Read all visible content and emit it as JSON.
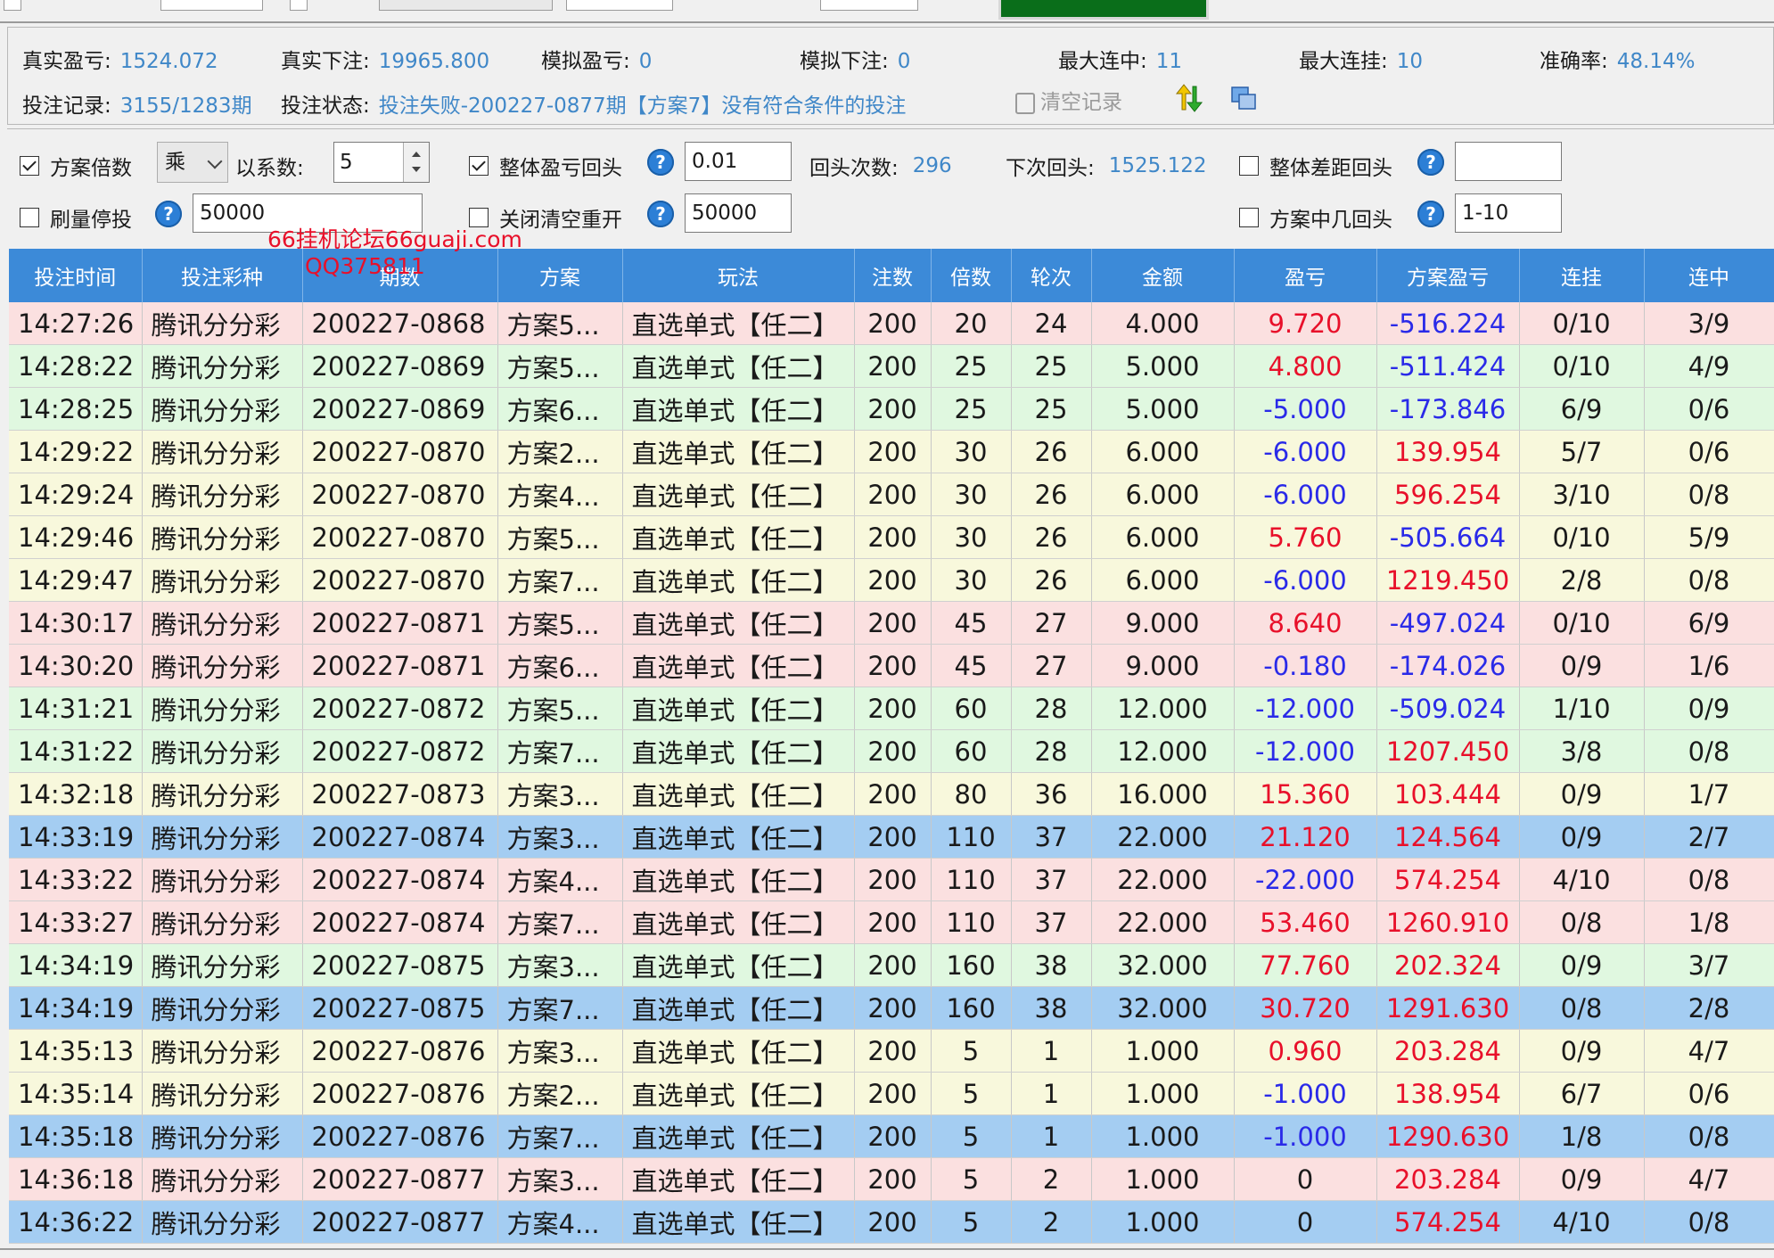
{
  "colors": {
    "header_bg": "#3c8ad8",
    "value_blue": "#3f87c8",
    "profit_red": "#e8102a",
    "loss_blue": "#2a2ae8",
    "row_pink": "#fbe0e0",
    "row_green": "#e0f8e0",
    "row_yellow": "#f8f8dc",
    "row_blue": "#a4cdf2"
  },
  "stats": {
    "real_profit": {
      "label": "真实盈亏:",
      "value": "1524.072"
    },
    "real_bet": {
      "label": "真实下注:",
      "value": "19965.800"
    },
    "sim_profit": {
      "label": "模拟盈亏:",
      "value": "0"
    },
    "sim_bet": {
      "label": "模拟下注:",
      "value": "0"
    },
    "max_win_streak": {
      "label": "最大连中:",
      "value": "11"
    },
    "max_loss_streak": {
      "label": "最大连挂:",
      "value": "10"
    },
    "accuracy": {
      "label": "准确率:",
      "value": "48.14%"
    },
    "bet_record": {
      "label": "投注记录:",
      "value": "3155/1283期"
    },
    "bet_status": {
      "label": "投注状态:",
      "value": "投注失败-200227-0877期【方案7】没有符合条件的投注"
    },
    "clear_label": "清空记录",
    "clear_icon": "trash-icon",
    "sort_icon": "up-down-arrows-icon",
    "window_icon": "window-icon"
  },
  "settings": {
    "plan_multiplier": {
      "label": "方案倍数",
      "checked": true,
      "op": "乘",
      "coef_label": "以系数:",
      "coef": "5"
    },
    "overall_rewind": {
      "label": "整体盈亏回头",
      "checked": true,
      "value": "0.01",
      "count_label": "回头次数:",
      "count": "296",
      "next_label": "下次回头:",
      "next": "1525.122"
    },
    "diff_rewind": {
      "label": "整体差距回头",
      "checked": false,
      "value": ""
    },
    "volume_stop": {
      "label": "刷量停投",
      "checked": false,
      "value": "50000"
    },
    "close_clear_reopen": {
      "label": "关闭清空重开",
      "checked": false,
      "value": "50000"
    },
    "plan_hit_rewind": {
      "label": "方案中几回头",
      "checked": false,
      "value": "1-10"
    },
    "help_glyph": "?"
  },
  "watermark": {
    "line1": "66挂机论坛66guaji.com",
    "line2": "QQ375811"
  },
  "table": {
    "columns": [
      "投注时间",
      "投注彩种",
      "期数",
      "方案",
      "玩法",
      "注数",
      "倍数",
      "轮次",
      "金额",
      "盈亏",
      "方案盈亏",
      "连挂",
      "连中"
    ],
    "rows": [
      {
        "color": "pink",
        "cells": [
          "14:27:26",
          "腾讯分分彩",
          "200227-0868",
          "方案5...",
          "直选单式【任二】",
          "200",
          "20",
          "24",
          "4.000",
          "9.720",
          "-516.224",
          "0/10",
          "3/9"
        ]
      },
      {
        "color": "green",
        "cells": [
          "14:28:22",
          "腾讯分分彩",
          "200227-0869",
          "方案5...",
          "直选单式【任二】",
          "200",
          "25",
          "25",
          "5.000",
          "4.800",
          "-511.424",
          "0/10",
          "4/9"
        ]
      },
      {
        "color": "green",
        "cells": [
          "14:28:25",
          "腾讯分分彩",
          "200227-0869",
          "方案6...",
          "直选单式【任二】",
          "200",
          "25",
          "25",
          "5.000",
          "-5.000",
          "-173.846",
          "6/9",
          "0/6"
        ]
      },
      {
        "color": "yellow",
        "cells": [
          "14:29:22",
          "腾讯分分彩",
          "200227-0870",
          "方案2...",
          "直选单式【任二】",
          "200",
          "30",
          "26",
          "6.000",
          "-6.000",
          "139.954",
          "5/7",
          "0/6"
        ]
      },
      {
        "color": "yellow",
        "cells": [
          "14:29:24",
          "腾讯分分彩",
          "200227-0870",
          "方案4...",
          "直选单式【任二】",
          "200",
          "30",
          "26",
          "6.000",
          "-6.000",
          "596.254",
          "3/10",
          "0/8"
        ]
      },
      {
        "color": "yellow",
        "cells": [
          "14:29:46",
          "腾讯分分彩",
          "200227-0870",
          "方案5...",
          "直选单式【任二】",
          "200",
          "30",
          "26",
          "6.000",
          "5.760",
          "-505.664",
          "0/10",
          "5/9"
        ]
      },
      {
        "color": "yellow",
        "cells": [
          "14:29:47",
          "腾讯分分彩",
          "200227-0870",
          "方案7...",
          "直选单式【任二】",
          "200",
          "30",
          "26",
          "6.000",
          "-6.000",
          "1219.450",
          "2/8",
          "0/8"
        ]
      },
      {
        "color": "pink",
        "cells": [
          "14:30:17",
          "腾讯分分彩",
          "200227-0871",
          "方案5...",
          "直选单式【任二】",
          "200",
          "45",
          "27",
          "9.000",
          "8.640",
          "-497.024",
          "0/10",
          "6/9"
        ]
      },
      {
        "color": "pink",
        "cells": [
          "14:30:20",
          "腾讯分分彩",
          "200227-0871",
          "方案6...",
          "直选单式【任二】",
          "200",
          "45",
          "27",
          "9.000",
          "-0.180",
          "-174.026",
          "0/9",
          "1/6"
        ]
      },
      {
        "color": "green",
        "cells": [
          "14:31:21",
          "腾讯分分彩",
          "200227-0872",
          "方案5...",
          "直选单式【任二】",
          "200",
          "60",
          "28",
          "12.000",
          "-12.000",
          "-509.024",
          "1/10",
          "0/9"
        ]
      },
      {
        "color": "green",
        "cells": [
          "14:31:22",
          "腾讯分分彩",
          "200227-0872",
          "方案7...",
          "直选单式【任二】",
          "200",
          "60",
          "28",
          "12.000",
          "-12.000",
          "1207.450",
          "3/8",
          "0/8"
        ]
      },
      {
        "color": "yellow",
        "cells": [
          "14:32:18",
          "腾讯分分彩",
          "200227-0873",
          "方案3...",
          "直选单式【任二】",
          "200",
          "80",
          "36",
          "16.000",
          "15.360",
          "103.444",
          "0/9",
          "1/7"
        ]
      },
      {
        "color": "blue",
        "cells": [
          "14:33:19",
          "腾讯分分彩",
          "200227-0874",
          "方案3...",
          "直选单式【任二】",
          "200",
          "110",
          "37",
          "22.000",
          "21.120",
          "124.564",
          "0/9",
          "2/7"
        ]
      },
      {
        "color": "pink",
        "cells": [
          "14:33:22",
          "腾讯分分彩",
          "200227-0874",
          "方案4...",
          "直选单式【任二】",
          "200",
          "110",
          "37",
          "22.000",
          "-22.000",
          "574.254",
          "4/10",
          "0/8"
        ]
      },
      {
        "color": "pink",
        "cells": [
          "14:33:27",
          "腾讯分分彩",
          "200227-0874",
          "方案7...",
          "直选单式【任二】",
          "200",
          "110",
          "37",
          "22.000",
          "53.460",
          "1260.910",
          "0/8",
          "1/8"
        ]
      },
      {
        "color": "green",
        "cells": [
          "14:34:19",
          "腾讯分分彩",
          "200227-0875",
          "方案3...",
          "直选单式【任二】",
          "200",
          "160",
          "38",
          "32.000",
          "77.760",
          "202.324",
          "0/9",
          "3/7"
        ]
      },
      {
        "color": "blue",
        "cells": [
          "14:34:19",
          "腾讯分分彩",
          "200227-0875",
          "方案7...",
          "直选单式【任二】",
          "200",
          "160",
          "38",
          "32.000",
          "30.720",
          "1291.630",
          "0/8",
          "2/8"
        ]
      },
      {
        "color": "yellow",
        "cells": [
          "14:35:13",
          "腾讯分分彩",
          "200227-0876",
          "方案3...",
          "直选单式【任二】",
          "200",
          "5",
          "1",
          "1.000",
          "0.960",
          "203.284",
          "0/9",
          "4/7"
        ]
      },
      {
        "color": "yellow",
        "cells": [
          "14:35:14",
          "腾讯分分彩",
          "200227-0876",
          "方案2...",
          "直选单式【任二】",
          "200",
          "5",
          "1",
          "1.000",
          "-1.000",
          "138.954",
          "6/7",
          "0/6"
        ]
      },
      {
        "color": "blue",
        "cells": [
          "14:35:18",
          "腾讯分分彩",
          "200227-0876",
          "方案7...",
          "直选单式【任二】",
          "200",
          "5",
          "1",
          "1.000",
          "-1.000",
          "1290.630",
          "1/8",
          "0/8"
        ]
      },
      {
        "color": "pink",
        "cells": [
          "14:36:18",
          "腾讯分分彩",
          "200227-0877",
          "方案3...",
          "直选单式【任二】",
          "200",
          "5",
          "2",
          "1.000",
          "0",
          "203.284",
          "0/9",
          "4/7"
        ]
      },
      {
        "color": "blue",
        "cells": [
          "14:36:22",
          "腾讯分分彩",
          "200227-0877",
          "方案4...",
          "直选单式【任二】",
          "200",
          "5",
          "2",
          "1.000",
          "0",
          "574.254",
          "4/10",
          "0/8"
        ]
      }
    ]
  }
}
